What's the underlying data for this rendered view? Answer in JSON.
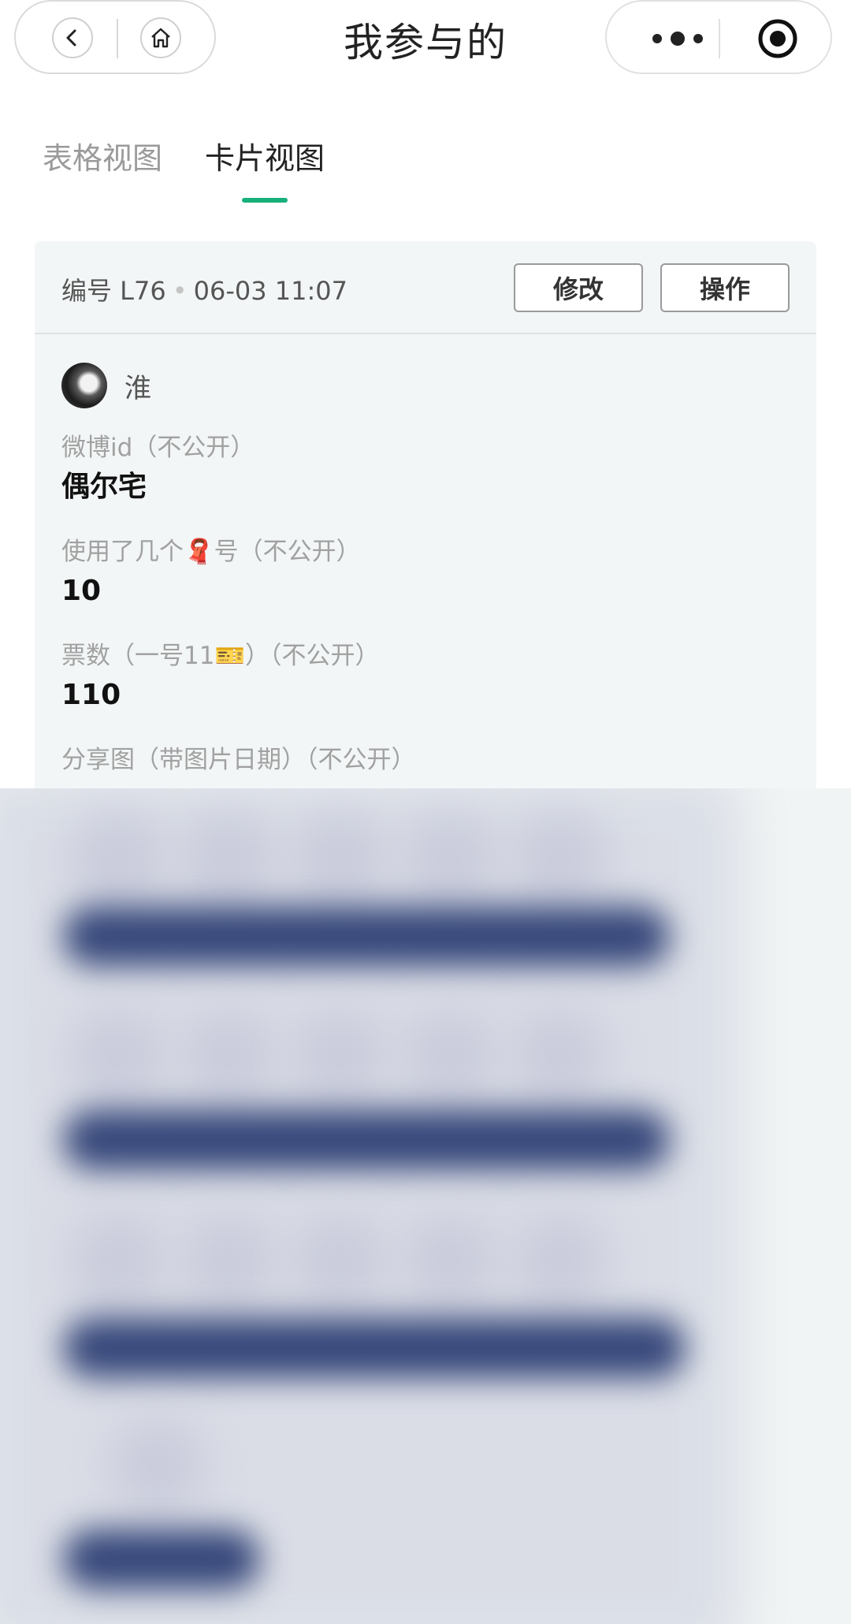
{
  "header": {
    "title": "我参与的",
    "back_icon": "chevron-left-icon",
    "home_icon": "home-icon",
    "more_icon": "more-dots-icon",
    "close_icon": "target-close-icon"
  },
  "tabs": [
    {
      "label": "表格视图",
      "active": false
    },
    {
      "label": "卡片视图",
      "active": true
    }
  ],
  "card": {
    "id_label": "编号 L76",
    "separator": "•",
    "datetime": "06-03 11:07",
    "edit_label": "修改",
    "ops_label": "操作",
    "user_name": "淮",
    "fields": [
      {
        "label": "微博id（不公开）",
        "value": "偶尔宅"
      },
      {
        "label": "使用了几个🧣号（不公开）",
        "value": "10"
      },
      {
        "label": "票数（一号11🎫）（不公开）",
        "value": "110"
      },
      {
        "label": "分享图（带图片日期）（不公开）",
        "value": ""
      }
    ]
  },
  "colors": {
    "accent": "#18b07a",
    "card_bg": "#f3f6f6",
    "blurred_bar": "#36477a"
  }
}
